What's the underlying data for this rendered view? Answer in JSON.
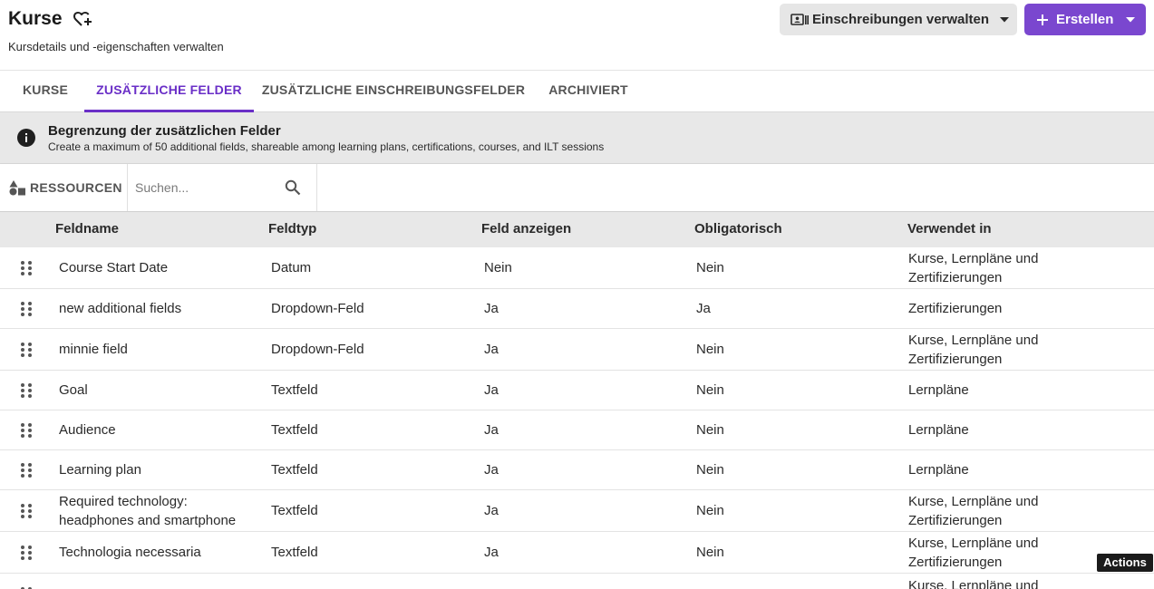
{
  "header": {
    "title": "Kurse",
    "subtitle": "Kursdetails und -eigenschaften verwalten",
    "enroll_button": "Einschreibungen verwalten",
    "create_button": "Erstellen",
    "accent_color": "#7a47cf"
  },
  "tabs": [
    {
      "label": "KURSE",
      "active": false
    },
    {
      "label": "ZUSÄTZLICHE FELDER",
      "active": true
    },
    {
      "label": "ZUSÄTZLICHE EINSCHREIBUNGSFELDER",
      "active": false
    },
    {
      "label": "ARCHIVIERT",
      "active": false
    }
  ],
  "banner": {
    "icon": "info-icon",
    "title": "Begrenzung der zusätzlichen Felder",
    "text": "Create a maximum of 50 additional fields, shareable among learning plans, certifications, courses, and ILT sessions"
  },
  "toolbar": {
    "resources_label": "RESSOURCEN",
    "search_placeholder": "Suchen...",
    "search_value": ""
  },
  "table": {
    "columns": [
      "Feldname",
      "Feldtyp",
      "Feld anzeigen",
      "Obligatorisch",
      "Verwendet in"
    ],
    "rows": [
      {
        "name": "Course Start Date",
        "type": "Datum",
        "show": "Nein",
        "mandatory": "Nein",
        "used_in": "Kurse, Lernpläne und Zertifizierungen"
      },
      {
        "name": "new additional fields",
        "type": "Dropdown-Feld",
        "show": "Ja",
        "mandatory": "Ja",
        "used_in": "Zertifizierungen"
      },
      {
        "name": "minnie field",
        "type": "Dropdown-Feld",
        "show": "Ja",
        "mandatory": "Nein",
        "used_in": "Kurse, Lernpläne und Zertifizierungen"
      },
      {
        "name": "Goal",
        "type": "Textfeld",
        "show": "Ja",
        "mandatory": "Nein",
        "used_in": "Lernpläne"
      },
      {
        "name": "Audience",
        "type": "Textfeld",
        "show": "Ja",
        "mandatory": "Nein",
        "used_in": "Lernpläne"
      },
      {
        "name": "Learning plan",
        "type": "Textfeld",
        "show": "Ja",
        "mandatory": "Nein",
        "used_in": "Lernpläne"
      },
      {
        "name": "Required technology: headphones and smartphone",
        "type": "Textfeld",
        "show": "Ja",
        "mandatory": "Nein",
        "used_in": "Kurse, Lernpläne und Zertifizierungen"
      },
      {
        "name": "Technologia necessaria",
        "type": "Textfeld",
        "show": "Ja",
        "mandatory": "Nein",
        "used_in": "Kurse, Lernpläne und Zertifizierungen"
      },
      {
        "name": "",
        "type": "",
        "show": "",
        "mandatory": "",
        "used_in": "Kurse, Lernpläne und"
      }
    ]
  },
  "tooltip": {
    "label": "Actions"
  }
}
